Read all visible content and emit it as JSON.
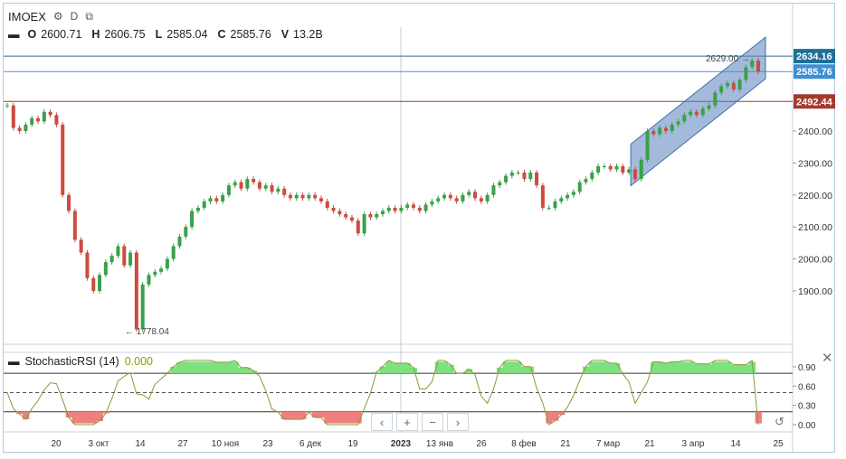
{
  "header": {
    "symbol": "IMOEX",
    "interval": "D",
    "gear_icon": "gear-icon",
    "fullscreen_icon": "fullscreen-icon"
  },
  "ohlc": {
    "o_label": "O",
    "o_value": "2600.71",
    "h_label": "H",
    "h_value": "2606.75",
    "l_label": "L",
    "l_value": "2585.04",
    "c_label": "C",
    "c_value": "2585.76",
    "v_label": "V",
    "v_value": "13.2B"
  },
  "price_badges": [
    {
      "label": "2634.16",
      "value": 2634.16,
      "color": "#1f6f96"
    },
    {
      "label": "2585.76",
      "value": 2585.76,
      "color": "#3d8fd1"
    },
    {
      "label": "2492.44",
      "value": 2492.44,
      "color": "#a33a2e"
    }
  ],
  "oscillator": {
    "title": "StochasticRSI (14)",
    "value": "0.000",
    "ticks": [
      "0.90",
      "0.60",
      "0.30",
      "0.00"
    ],
    "tick_values": [
      0.9,
      0.6,
      0.3,
      0.0
    ]
  },
  "chart_data": {
    "type": "candlestick",
    "y_ticks": [
      "2400.00",
      "2300.00",
      "2200.00",
      "2100.00",
      "2000.00",
      "1900.00"
    ],
    "y_tick_values": [
      2400,
      2300,
      2200,
      2100,
      2000,
      1900
    ],
    "x_ticks": [
      "20",
      "3 окт",
      "14",
      "27",
      "10 ноя",
      "23",
      "6 дек",
      "19",
      "2023",
      "13 янв",
      "26",
      "8 фев",
      "21",
      "7 мар",
      "21",
      "3 апр",
      "14",
      "25"
    ],
    "annotations": [
      {
        "text": "← 1778.04",
        "value": 1778.04
      },
      {
        "text": "2629.00 →",
        "value": 2629.0
      }
    ],
    "horizontal_lines": [
      2634.16,
      2585.76,
      2492.44
    ],
    "channel": {
      "from_date": "2023-03-21",
      "to_date": "2023-04-17"
    },
    "close_series": [
      2480,
      2410,
      2400,
      2420,
      2440,
      2430,
      2460,
      2450,
      2420,
      2200,
      2150,
      2060,
      2020,
      1940,
      1900,
      1950,
      1990,
      2010,
      2040,
      1980,
      2020,
      1780,
      1920,
      1950,
      1960,
      1970,
      2000,
      2040,
      2070,
      2100,
      2150,
      2160,
      2180,
      2190,
      2180,
      2200,
      2230,
      2240,
      2220,
      2250,
      2240,
      2220,
      2230,
      2210,
      2220,
      2200,
      2190,
      2200,
      2190,
      2200,
      2190,
      2180,
      2160,
      2150,
      2140,
      2130,
      2120,
      2080,
      2140,
      2130,
      2140,
      2150,
      2160,
      2150,
      2160,
      2170,
      2160,
      2150,
      2170,
      2180,
      2190,
      2200,
      2190,
      2180,
      2200,
      2210,
      2190,
      2180,
      2200,
      2230,
      2240,
      2260,
      2270,
      2270,
      2250,
      2270,
      2230,
      2160,
      2160,
      2180,
      2190,
      2200,
      2210,
      2240,
      2250,
      2270,
      2290,
      2290,
      2280,
      2290,
      2270,
      2280,
      2250,
      2310,
      2400,
      2390,
      2410,
      2400,
      2420,
      2430,
      2450,
      2460,
      2450,
      2470,
      2480,
      2520,
      2540,
      2550,
      2530,
      2560,
      2600,
      2620,
      2586
    ]
  }
}
